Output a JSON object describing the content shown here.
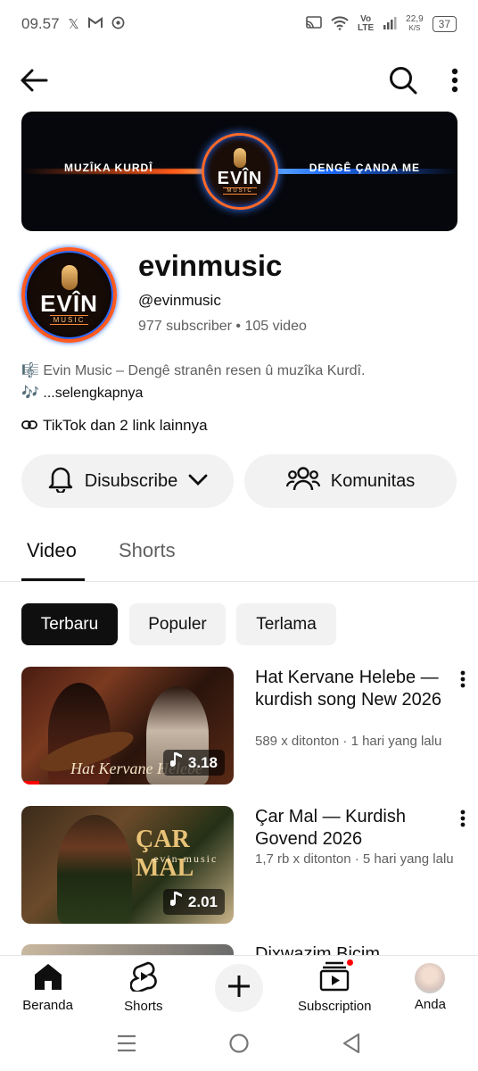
{
  "status_bar": {
    "time": "09.57",
    "net_speed_value": "22,9",
    "net_speed_unit": "K/S",
    "battery": "37",
    "network_label": "Vo\nLTE"
  },
  "banner": {
    "left_text": "MUZÎKA KURDÎ",
    "right_text": "DENGÊ ÇANDA ME",
    "logo_word": "EVÎN",
    "logo_sub": "MUSIC"
  },
  "channel": {
    "name": "evinmusic",
    "handle": "@evinmusic",
    "subscribers": "977 subscriber",
    "separator": "•",
    "videos": "105 video",
    "description": "🎼 Evin Music – Dengê stranên resen û muzîka Kurdî.",
    "description_more_prefix": "🎶 ",
    "description_more": "...selengkapnya",
    "links": "TikTok dan 2 link lainnya"
  },
  "actions": {
    "subscribe_label": "Disubscribe",
    "community_label": "Komunitas"
  },
  "tabs": [
    {
      "label": "Video"
    },
    {
      "label": "Shorts"
    }
  ],
  "chips": [
    {
      "label": "Terbaru"
    },
    {
      "label": "Populer"
    },
    {
      "label": "Terlama"
    }
  ],
  "videos": [
    {
      "title": "Hat Kervane Helebe — kurdish song New 2026",
      "meta": "589 x ditonton · 1 hari yang lalu",
      "duration": "3.18",
      "thumb_text": "Hat Kervane Helebe"
    },
    {
      "title": "Çar Mal — Kurdish Govend 2026",
      "meta": "1,7 rb x ditonton · 5 hari yang lalu",
      "duration": "2.01",
      "thumb_text": "ÇAR MAL",
      "thumb_sub": "evin music"
    }
  ],
  "peek_video_title": "Dixwazim Bicim",
  "bottom_nav": [
    {
      "label": "Beranda"
    },
    {
      "label": "Shorts"
    },
    {
      "label": ""
    },
    {
      "label": "Subscription"
    },
    {
      "label": "Anda"
    }
  ]
}
